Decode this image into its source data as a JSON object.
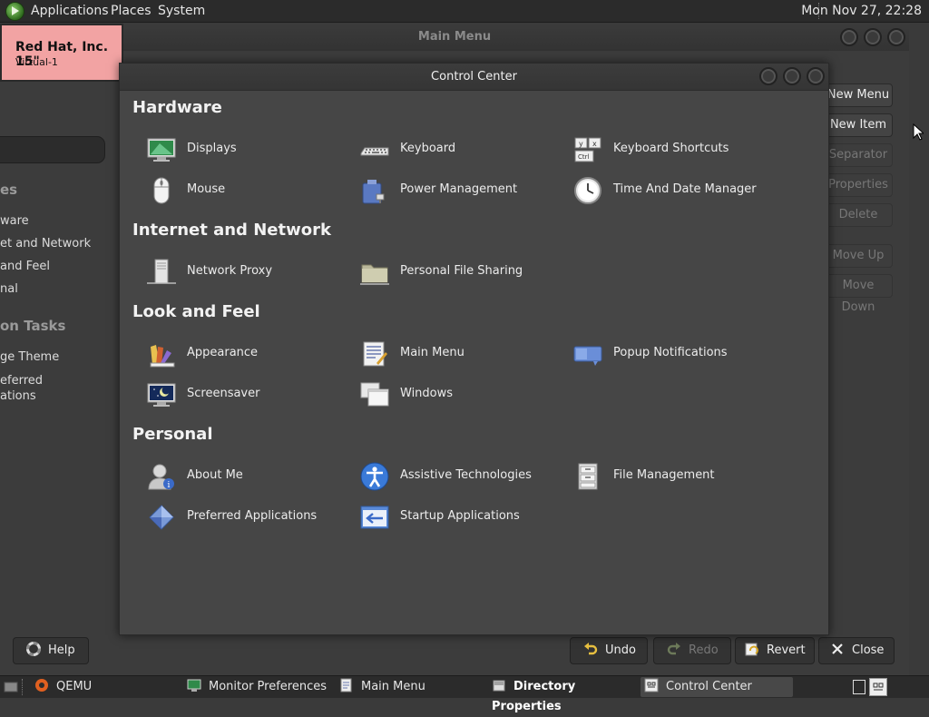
{
  "top_panel": {
    "menus": [
      "Applications",
      "Places",
      "System"
    ],
    "clock": "Mon Nov 27, 22:28"
  },
  "monitor_label": {
    "title": "Red Hat, Inc. 15\"",
    "subtitle": "Virtual-1"
  },
  "main_menu_window": {
    "title": "Main Menu",
    "categories_header": "es",
    "categories": [
      "ware",
      "et and Network",
      "and Feel",
      "nal"
    ],
    "tasks_header": "on Tasks",
    "tasks": [
      "ge Theme",
      "eferred",
      "ations"
    ],
    "side_buttons": [
      "New Menu",
      "New Item",
      "Separator",
      "Properties",
      "Delete",
      "Move Up",
      "Move Down"
    ],
    "bottom_buttons": {
      "help": "Help",
      "undo": "Undo",
      "redo": "Redo",
      "revert": "Revert",
      "close": "Close"
    }
  },
  "control_center": {
    "title": "Control Center",
    "sections": [
      {
        "heading": "Hardware",
        "items": [
          {
            "label": "Displays",
            "icon": "display-icon"
          },
          {
            "label": "Keyboard",
            "icon": "keyboard-icon"
          },
          {
            "label": "Keyboard Shortcuts",
            "icon": "keyboard-shortcuts-icon"
          },
          {
            "label": "Mouse",
            "icon": "mouse-icon"
          },
          {
            "label": "Power Management",
            "icon": "power-icon"
          },
          {
            "label": "Time And Date Manager",
            "icon": "clock-icon"
          }
        ]
      },
      {
        "heading": "Internet and Network",
        "items": [
          {
            "label": "Network Proxy",
            "icon": "network-proxy-icon"
          },
          {
            "label": "Personal File Sharing",
            "icon": "folder-share-icon"
          }
        ]
      },
      {
        "heading": "Look and Feel",
        "items": [
          {
            "label": "Appearance",
            "icon": "appearance-icon"
          },
          {
            "label": "Main Menu",
            "icon": "main-menu-icon"
          },
          {
            "label": "Popup Notifications",
            "icon": "notification-icon"
          },
          {
            "label": "Screensaver",
            "icon": "screensaver-icon"
          },
          {
            "label": "Windows",
            "icon": "windows-icon"
          }
        ]
      },
      {
        "heading": "Personal",
        "items": [
          {
            "label": "About Me",
            "icon": "about-me-icon"
          },
          {
            "label": "Assistive Technologies",
            "icon": "accessibility-icon"
          },
          {
            "label": "File Management",
            "icon": "file-cabinet-icon"
          },
          {
            "label": "Preferred Applications",
            "icon": "preferred-apps-icon"
          },
          {
            "label": "Startup Applications",
            "icon": "startup-icon"
          }
        ]
      }
    ]
  },
  "bottom_panel": {
    "tasks": [
      "QEMU",
      "Monitor Preferences",
      "Main Menu",
      "Directory Properties",
      "Control Center"
    ]
  },
  "colors": {
    "panel": "#2b2b2b",
    "window_bg": "#464646",
    "monitor_label": "#f2a3a3"
  }
}
